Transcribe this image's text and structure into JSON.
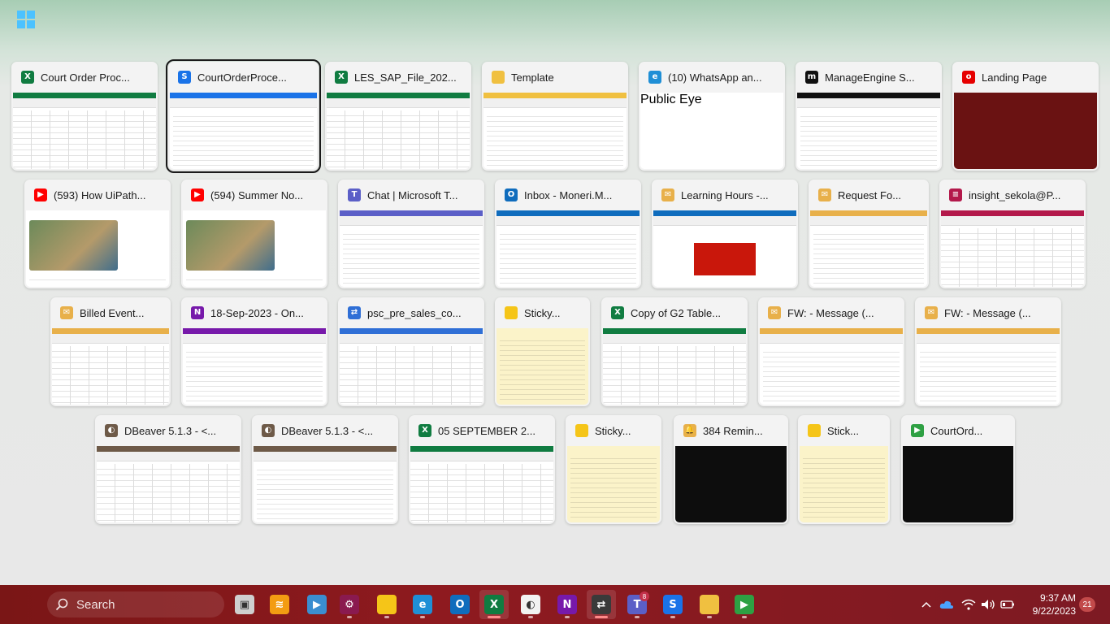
{
  "windows": [
    {
      "title": "Court Order Proc...",
      "app": "excel",
      "icon_color": "#107c41",
      "glyph": "X",
      "thumb": "sheet"
    },
    {
      "title": "CourtOrderProce...",
      "app": "uipath",
      "icon_color": "#1a73e8",
      "glyph": "S",
      "thumb": "doc",
      "selected": true
    },
    {
      "title": "LES_SAP_File_202...",
      "app": "excel",
      "icon_color": "#107c41",
      "glyph": "X",
      "thumb": "sheet"
    },
    {
      "title": "Template",
      "app": "file-explorer",
      "icon_color": "#f0c040",
      "glyph": "",
      "thumb": "doc"
    },
    {
      "title": "(10) WhatsApp an...",
      "app": "edge",
      "icon_color": "#1f8fd6",
      "glyph": "e",
      "thumb": "whatsapp",
      "panel_text": "Public Eye"
    },
    {
      "title": "ManageEngine S...",
      "app": "manageengine",
      "icon_color": "#111111",
      "glyph": "m",
      "thumb": "doc"
    },
    {
      "title": "Landing Page",
      "app": "vodafone",
      "icon_color": "#e60000",
      "glyph": "o",
      "thumb": "landing"
    },
    {
      "title": "(593) How UiPath...",
      "app": "youtube",
      "icon_color": "#ff0000",
      "glyph": "▶",
      "thumb": "video"
    },
    {
      "title": "(594) Summer No...",
      "app": "youtube",
      "icon_color": "#ff0000",
      "glyph": "▶",
      "thumb": "video"
    },
    {
      "title": "Chat | Microsoft T...",
      "app": "teams",
      "icon_color": "#5b5fc7",
      "glyph": "T",
      "thumb": "doc"
    },
    {
      "title": "Inbox - Moneri.M...",
      "app": "outlook",
      "icon_color": "#0f6cbd",
      "glyph": "O",
      "thumb": "doc"
    },
    {
      "title": "Learning Hours -...",
      "app": "mail",
      "icon_color": "#e8b04a",
      "glyph": "✉",
      "thumb": "red"
    },
    {
      "title": "Request Fo...",
      "app": "mail",
      "icon_color": "#e8b04a",
      "glyph": "✉",
      "thumb": "doc"
    },
    {
      "title": "insight_sekola@P...",
      "app": "sql",
      "icon_color": "#b3194b",
      "glyph": "≡",
      "thumb": "sheet"
    },
    {
      "title": "Billed Event...",
      "app": "mail",
      "icon_color": "#e8b04a",
      "glyph": "✉",
      "thumb": "sheet"
    },
    {
      "title": "18-Sep-2023 - On...",
      "app": "onenote",
      "icon_color": "#7719aa",
      "glyph": "N",
      "thumb": "doc"
    },
    {
      "title": "psc_pre_sales_co...",
      "app": "winscp",
      "icon_color": "#2f6fd6",
      "glyph": "⇄",
      "thumb": "sheet"
    },
    {
      "title": "Sticky...",
      "app": "sticky-notes",
      "icon_color": "#f5c518",
      "glyph": "",
      "thumb": "sticky"
    },
    {
      "title": "Copy of G2 Table...",
      "app": "excel",
      "icon_color": "#107c41",
      "glyph": "X",
      "thumb": "sheet"
    },
    {
      "title": "FW:  - Message (...",
      "app": "mail",
      "icon_color": "#e8b04a",
      "glyph": "✉",
      "thumb": "doc"
    },
    {
      "title": "FW:  - Message (...",
      "app": "mail",
      "icon_color": "#e8b04a",
      "glyph": "✉",
      "thumb": "doc"
    },
    {
      "title": "DBeaver 5.1.3 - <...",
      "app": "dbeaver",
      "icon_color": "#6e5a48",
      "glyph": "◐",
      "thumb": "sheet"
    },
    {
      "title": "DBeaver 5.1.3 - <...",
      "app": "dbeaver",
      "icon_color": "#6e5a48",
      "glyph": "◐",
      "thumb": "doc"
    },
    {
      "title": "05 SEPTEMBER 2...",
      "app": "excel",
      "icon_color": "#107c41",
      "glyph": "X",
      "thumb": "sheet"
    },
    {
      "title": "Sticky...",
      "app": "sticky-notes",
      "icon_color": "#f5c518",
      "glyph": "",
      "thumb": "sticky"
    },
    {
      "title": "384 Remin...",
      "app": "reminder",
      "icon_color": "#e8b04a",
      "glyph": "🔔",
      "thumb": "dark"
    },
    {
      "title": "Stick...",
      "app": "sticky-notes",
      "icon_color": "#f5c518",
      "glyph": "",
      "thumb": "sticky"
    },
    {
      "title": "CourtOrd...",
      "app": "uipath-player",
      "icon_color": "#2ea043",
      "glyph": "▶",
      "thumb": "dark"
    }
  ],
  "taskbar": {
    "search_label": "Search",
    "apps": [
      {
        "name": "task-view",
        "color": "#cfcfcf",
        "glyph": "▣",
        "dot": false
      },
      {
        "name": "uipath-assistant",
        "color": "#f39c12",
        "glyph": "≋",
        "dot": false
      },
      {
        "name": "uipath-player",
        "color": "#3b8ed0",
        "glyph": "▶",
        "dot": false
      },
      {
        "name": "settings",
        "color": "#8a1a4f",
        "glyph": "⚙",
        "dot": true
      },
      {
        "name": "sticky-notes",
        "color": "#f5c518",
        "glyph": "",
        "dot": true
      },
      {
        "name": "edge",
        "color": "#1f8fd6",
        "glyph": "e",
        "dot": true
      },
      {
        "name": "outlook",
        "color": "#0f6cbd",
        "glyph": "O",
        "dot": true
      },
      {
        "name": "excel",
        "color": "#107c41",
        "glyph": "X",
        "dot": true,
        "active": true
      },
      {
        "name": "dbeaver",
        "color": "#f2f2f2",
        "glyph": "◐",
        "dot": true
      },
      {
        "name": "onenote",
        "color": "#7719aa",
        "glyph": "N",
        "dot": true
      },
      {
        "name": "winscp",
        "color": "#3a3a3a",
        "glyph": "⇄",
        "dot": true,
        "active": true
      },
      {
        "name": "teams",
        "color": "#5b5fc7",
        "glyph": "T",
        "dot": true,
        "badge": "8"
      },
      {
        "name": "uipath-studio",
        "color": "#1a73e8",
        "glyph": "S",
        "dot": true
      },
      {
        "name": "file-explorer",
        "color": "#f0c040",
        "glyph": "",
        "dot": true
      },
      {
        "name": "uipath-robot",
        "color": "#2ea043",
        "glyph": "▶",
        "dot": true
      }
    ],
    "time": "9:37 AM",
    "date": "9/22/2023",
    "notifications": "21"
  }
}
